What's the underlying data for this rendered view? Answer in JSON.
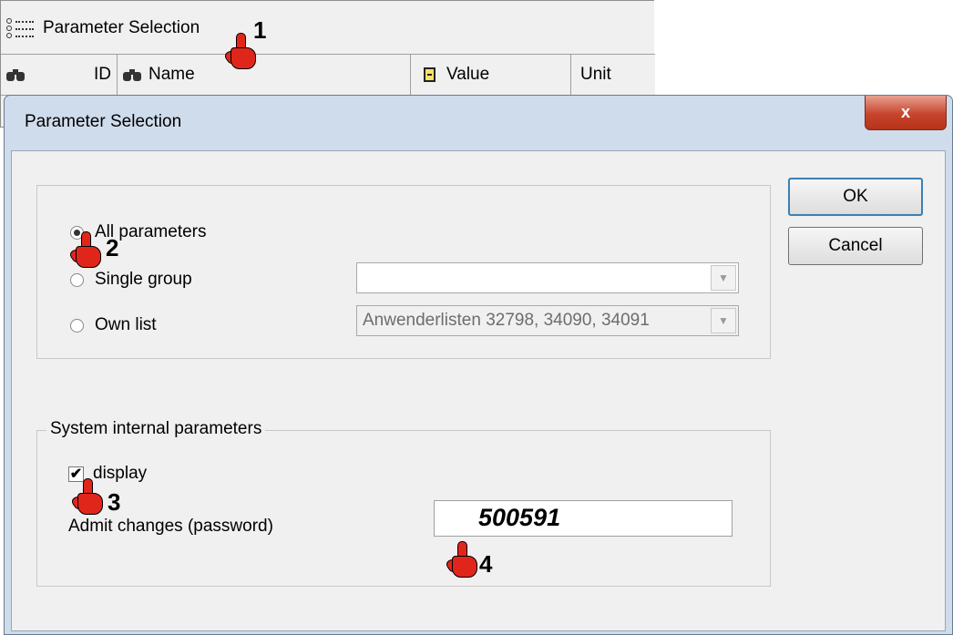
{
  "background_window": {
    "title": "Parameter Selection",
    "columns": [
      {
        "label": "ID",
        "icon": "binoculars-icon"
      },
      {
        "label": "Name",
        "icon": "binoculars-icon"
      },
      {
        "label": "Value",
        "icon": "value-icon"
      },
      {
        "label": "Unit"
      }
    ]
  },
  "dialog": {
    "title": "Parameter Selection",
    "close_label": "x",
    "selection": {
      "options": [
        {
          "label": "All parameters",
          "selected": true
        },
        {
          "label": "Single group",
          "selected": false
        },
        {
          "label": "Own list",
          "selected": false
        }
      ],
      "single_group_value": "",
      "own_list_value": "Anwenderlisten 32798, 34090, 34091"
    },
    "system_internal": {
      "legend": "System internal parameters",
      "display_label": "display",
      "display_checked": true,
      "password_label": "Admit changes (password)",
      "password_value": "500591"
    },
    "buttons": {
      "ok": "OK",
      "cancel": "Cancel"
    }
  },
  "annotations": [
    "1",
    "2",
    "3",
    "4"
  ],
  "colors": {
    "cursor": "#e0261b",
    "close_button": "#c7442d",
    "dialog_frame": "#cfdcec"
  }
}
